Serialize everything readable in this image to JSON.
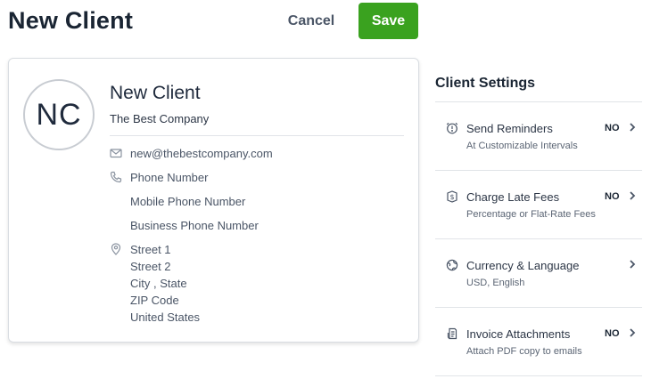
{
  "header": {
    "title": "New Client",
    "cancel_label": "Cancel",
    "save_label": "Save"
  },
  "client": {
    "initials": "NC",
    "name": "New Client",
    "company": "The Best Company",
    "email": "new@thebestcompany.com",
    "phone": "Phone Number",
    "mobile_phone": "Mobile Phone Number",
    "business_phone": "Business Phone Number",
    "street1": "Street 1",
    "street2": "Street 2",
    "city_state": "City , State",
    "zip": "ZIP Code",
    "country": "United States"
  },
  "settings": {
    "title": "Client Settings",
    "items": [
      {
        "icon": "alarm-clock-icon",
        "label": "Send Reminders",
        "sub": "At Customizable Intervals",
        "value": "NO"
      },
      {
        "icon": "dollar-badge-icon",
        "label": "Charge Late Fees",
        "sub": "Percentage or Flat-Rate Fees",
        "value": "NO"
      },
      {
        "icon": "globe-currency-icon",
        "label": "Currency & Language",
        "sub": "USD, English",
        "value": ""
      },
      {
        "icon": "paperclip-document-icon",
        "label": "Invoice Attachments",
        "sub": "Attach PDF copy to emails",
        "value": "NO"
      }
    ]
  },
  "colors": {
    "save_green": "#3aa21f",
    "text_dark": "#1a2533",
    "border": "#d9dde2"
  }
}
